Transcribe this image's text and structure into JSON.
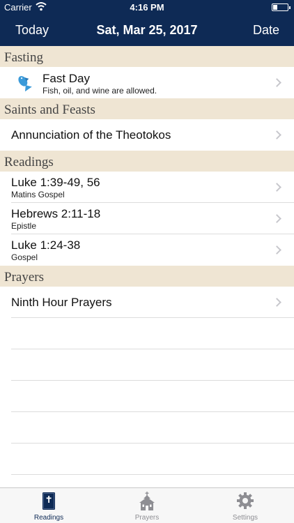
{
  "status_bar": {
    "carrier": "Carrier",
    "time": "4:16 PM"
  },
  "nav": {
    "left_label": "Today",
    "title": "Sat, Mar 25, 2017",
    "right_label": "Date"
  },
  "sections": {
    "fasting": {
      "header": "Fasting",
      "item": {
        "title": "Fast Day",
        "subtitle": "Fish, oil, and wine are allowed.",
        "icon": "fish-icon"
      }
    },
    "saints": {
      "header": "Saints and Feasts",
      "items": [
        {
          "title": "Annunciation of the Theotokos"
        }
      ]
    },
    "readings": {
      "header": "Readings",
      "items": [
        {
          "title": "Luke 1:39-49, 56",
          "subtitle": "Matins Gospel"
        },
        {
          "title": "Hebrews 2:11-18",
          "subtitle": "Epistle"
        },
        {
          "title": "Luke 1:24-38",
          "subtitle": "Gospel"
        }
      ]
    },
    "prayers": {
      "header": "Prayers",
      "items": [
        {
          "title": "Ninth Hour Prayers"
        }
      ]
    }
  },
  "tabs": [
    {
      "label": "Readings",
      "icon": "bible-icon",
      "active": true
    },
    {
      "label": "Prayers",
      "icon": "church-icon",
      "active": false
    },
    {
      "label": "Settings",
      "icon": "gear-icon",
      "active": false
    }
  ],
  "colors": {
    "nav_background": "#0e2a55",
    "section_header_background": "#efe5d3",
    "active_tab": "#0e2a55",
    "inactive_tab": "#8e8e93",
    "fish_icon": "#3a9ad9"
  }
}
